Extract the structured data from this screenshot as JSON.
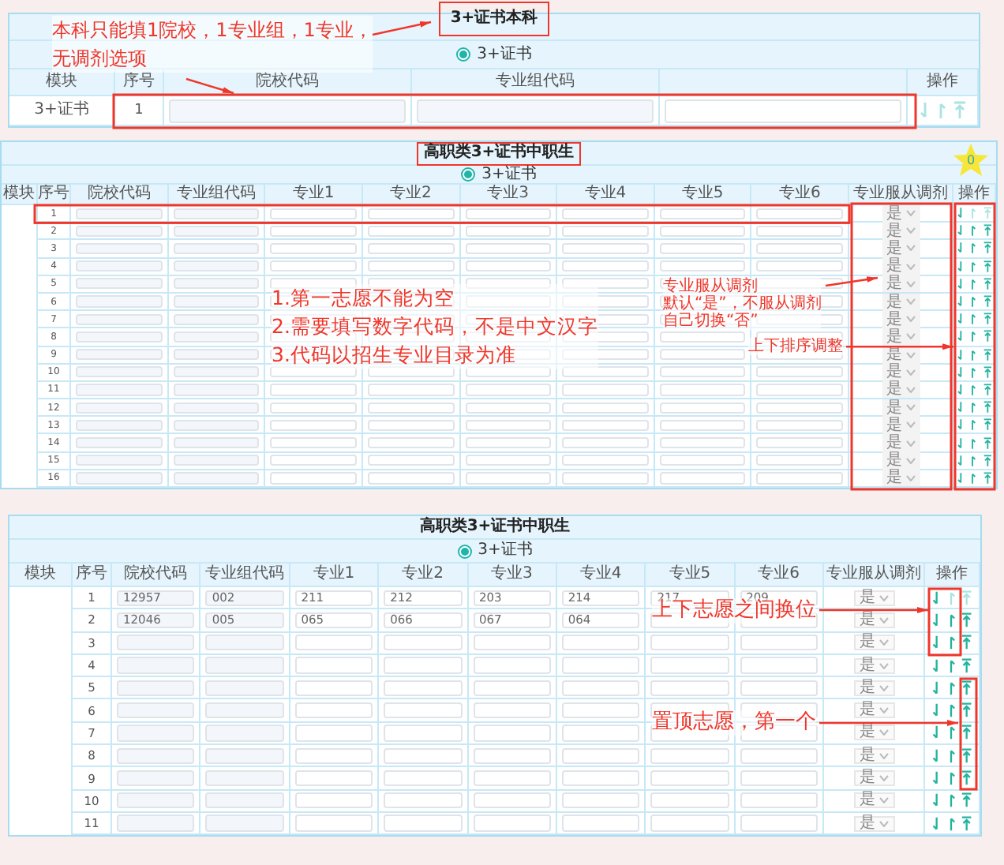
{
  "panels": [
    {
      "title": "3+证书本科",
      "radio": {
        "label": "3+证书",
        "selected": true
      },
      "columns": [
        {
          "label": "模块",
          "kind": "module"
        },
        {
          "label": "序号",
          "kind": "seq"
        },
        {
          "label": "院校代码",
          "kind": "school"
        },
        {
          "label": "专业组代码",
          "kind": "group"
        },
        {
          "kind": "major"
        },
        {
          "label": "操作",
          "kind": "ops"
        }
      ],
      "rows": [
        {
          "module": "3+证书",
          "seq": "1",
          "down_enabled": false,
          "up_enabled": false,
          "top_enabled": false
        }
      ]
    },
    {
      "title": "高职类3+证书中职生",
      "badge": "0",
      "radio": {
        "label": "3+证书",
        "selected": true
      },
      "columns": [
        {
          "label": "模块",
          "kind": "module"
        },
        {
          "label": "序号",
          "kind": "seq"
        },
        {
          "label": "院校代码",
          "kind": "school"
        },
        {
          "label": "专业组代码",
          "kind": "group"
        },
        {
          "label": "专业1",
          "kind": "major"
        },
        {
          "label": "专业2",
          "kind": "major"
        },
        {
          "label": "专业3",
          "kind": "major"
        },
        {
          "label": "专业4",
          "kind": "major"
        },
        {
          "label": "专业5",
          "kind": "major"
        },
        {
          "label": "专业6",
          "kind": "major"
        },
        {
          "label": "专业服从调剂",
          "kind": "adjust"
        },
        {
          "label": "操作",
          "kind": "ops"
        }
      ],
      "rows": [
        {
          "seq": "1",
          "adjust": "是",
          "down_enabled": true,
          "up_enabled": false,
          "top_enabled": false
        },
        {
          "seq": "2",
          "adjust": "是",
          "down_enabled": true,
          "up_enabled": true,
          "top_enabled": true
        },
        {
          "seq": "3",
          "adjust": "是",
          "down_enabled": true,
          "up_enabled": true,
          "top_enabled": true
        },
        {
          "seq": "4",
          "adjust": "是",
          "down_enabled": true,
          "up_enabled": true,
          "top_enabled": true
        },
        {
          "seq": "5",
          "adjust": "是",
          "down_enabled": true,
          "up_enabled": true,
          "top_enabled": true
        },
        {
          "seq": "6",
          "adjust": "是",
          "down_enabled": true,
          "up_enabled": true,
          "top_enabled": true
        },
        {
          "seq": "7",
          "adjust": "是",
          "down_enabled": true,
          "up_enabled": true,
          "top_enabled": true
        },
        {
          "seq": "8",
          "adjust": "是",
          "down_enabled": true,
          "up_enabled": true,
          "top_enabled": true
        },
        {
          "seq": "9",
          "adjust": "是",
          "down_enabled": true,
          "up_enabled": true,
          "top_enabled": true
        },
        {
          "seq": "10",
          "adjust": "是",
          "down_enabled": true,
          "up_enabled": true,
          "top_enabled": true
        },
        {
          "seq": "11",
          "adjust": "是",
          "down_enabled": true,
          "up_enabled": true,
          "top_enabled": true
        },
        {
          "seq": "12",
          "adjust": "是",
          "down_enabled": true,
          "up_enabled": true,
          "top_enabled": true
        },
        {
          "seq": "13",
          "adjust": "是",
          "down_enabled": true,
          "up_enabled": true,
          "top_enabled": true
        },
        {
          "seq": "14",
          "adjust": "是",
          "down_enabled": true,
          "up_enabled": true,
          "top_enabled": true
        },
        {
          "seq": "15",
          "adjust": "是",
          "down_enabled": true,
          "up_enabled": true,
          "top_enabled": true
        },
        {
          "seq": "16",
          "adjust": "是",
          "down_enabled": true,
          "up_enabled": true,
          "top_enabled": true
        }
      ]
    },
    {
      "title": "高职类3+证书中职生",
      "radio": {
        "label": "3+证书",
        "selected": true
      },
      "columns": [
        {
          "label": "模块",
          "kind": "module"
        },
        {
          "label": "序号",
          "kind": "seq"
        },
        {
          "label": "院校代码",
          "kind": "school"
        },
        {
          "label": "专业组代码",
          "kind": "group"
        },
        {
          "label": "专业1",
          "kind": "major"
        },
        {
          "label": "专业2",
          "kind": "major"
        },
        {
          "label": "专业3",
          "kind": "major"
        },
        {
          "label": "专业4",
          "kind": "major"
        },
        {
          "label": "专业5",
          "kind": "major"
        },
        {
          "label": "专业6",
          "kind": "major"
        },
        {
          "label": "专业服从调剂",
          "kind": "adjust"
        },
        {
          "label": "操作",
          "kind": "ops"
        }
      ],
      "rows": [
        {
          "seq": "1",
          "values": [
            "12957",
            "002",
            "211",
            "212",
            "203",
            "214",
            "217",
            "209"
          ],
          "adjust": "是",
          "down_enabled": true,
          "up_enabled": false,
          "top_enabled": false
        },
        {
          "seq": "2",
          "values": [
            "12046",
            "005",
            "065",
            "066",
            "067",
            "064"
          ],
          "adjust": "是",
          "down_enabled": true,
          "up_enabled": true,
          "top_enabled": true
        },
        {
          "seq": "3",
          "adjust": "是",
          "down_enabled": true,
          "up_enabled": true,
          "top_enabled": true
        },
        {
          "seq": "4",
          "adjust": "是",
          "down_enabled": true,
          "up_enabled": true,
          "top_enabled": true
        },
        {
          "seq": "5",
          "adjust": "是",
          "down_enabled": true,
          "up_enabled": true,
          "top_enabled": true
        },
        {
          "seq": "6",
          "adjust": "是",
          "down_enabled": true,
          "up_enabled": true,
          "top_enabled": true
        },
        {
          "seq": "7",
          "adjust": "是",
          "down_enabled": true,
          "up_enabled": true,
          "top_enabled": true
        },
        {
          "seq": "8",
          "adjust": "是",
          "down_enabled": true,
          "up_enabled": true,
          "top_enabled": true
        },
        {
          "seq": "9",
          "adjust": "是",
          "down_enabled": true,
          "up_enabled": true,
          "top_enabled": true
        },
        {
          "seq": "10",
          "adjust": "是",
          "down_enabled": true,
          "up_enabled": true,
          "top_enabled": true
        },
        {
          "seq": "11",
          "adjust": "是",
          "down_enabled": true,
          "up_enabled": true,
          "top_enabled": true
        }
      ]
    }
  ],
  "annotations": [
    {
      "lines": [
        "本科只能填1院校，1专业组，1专业，",
        "无调剂选项"
      ]
    },
    {
      "lines": [
        "1.第一志愿不能为空",
        "2.需要填写数字代码，不是中文汉字",
        "3.代码以招生专业目录为准"
      ]
    },
    {
      "lines": [
        "专业服从调剂",
        "默认“是”，不服从调剂",
        "自己切换“否”"
      ]
    },
    {
      "lines": [
        "上下排序调整"
      ]
    },
    {
      "lines": [
        "上下志愿之间换位"
      ]
    },
    {
      "lines": [
        "置顶志愿，第一个"
      ]
    }
  ]
}
